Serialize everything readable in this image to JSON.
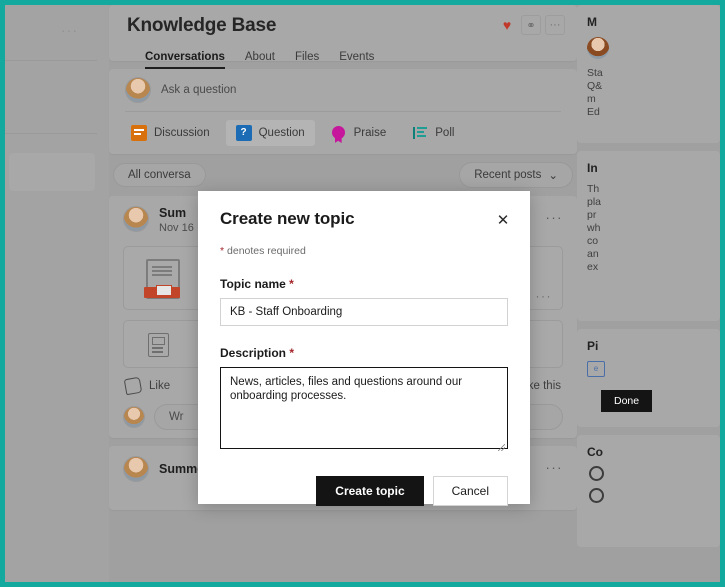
{
  "frame": {
    "border_color": "#14a99f"
  },
  "group": {
    "title": "Knowledge Base",
    "actions": [
      {
        "name": "heart-icon",
        "glyph": "♥"
      },
      {
        "name": "link-icon",
        "glyph": "⚭"
      },
      {
        "name": "more-icon",
        "glyph": "···"
      }
    ],
    "tabs": [
      {
        "label": "Conversations",
        "active": true
      },
      {
        "label": "About",
        "active": false
      },
      {
        "label": "Files",
        "active": false
      },
      {
        "label": "Events",
        "active": false
      }
    ]
  },
  "composer": {
    "placeholder": "Ask a question",
    "types": [
      {
        "label": "Discussion",
        "icon": "discussion-icon",
        "selected": false
      },
      {
        "label": "Question",
        "icon": "question-icon",
        "selected": true
      },
      {
        "label": "Praise",
        "icon": "praise-icon",
        "selected": false
      },
      {
        "label": "Poll",
        "icon": "poll-icon",
        "selected": false
      }
    ]
  },
  "filters": {
    "left_label": "All conversa",
    "right_label": "Recent posts",
    "chevron": "⌄"
  },
  "post": {
    "author": "Sum",
    "date": "Nov 16",
    "more": "···",
    "attachment_more": "···",
    "done_label": "Done",
    "like_label": "Like",
    "like_status": "Be the first to like this",
    "reply_placeholder": "Wr"
  },
  "post_bottom": {
    "author": "Summer Fischer",
    "more": "···"
  },
  "right_rail": {
    "cards": [
      {
        "title": "M",
        "lines": [
          "Sta",
          "Q&",
          "m",
          "Ed"
        ]
      },
      {
        "title": "In",
        "lines": [
          "Th",
          "pla",
          "pr",
          "wh",
          "co",
          "an",
          "ex"
        ]
      },
      {
        "title": "Pi",
        "lines": []
      },
      {
        "title": "Co",
        "lines": []
      }
    ]
  },
  "modal": {
    "title": "Create new topic",
    "close": "✕",
    "required_note_star": "*",
    "required_note": " denotes required",
    "topic_label": "Topic name",
    "topic_required": "*",
    "topic_value": "KB - Staff Onboarding",
    "description_label": "Description",
    "description_required": "*",
    "description_value": "News, articles, files and questions around our onboarding processes.",
    "primary_button": "Create topic",
    "secondary_button": "Cancel"
  }
}
